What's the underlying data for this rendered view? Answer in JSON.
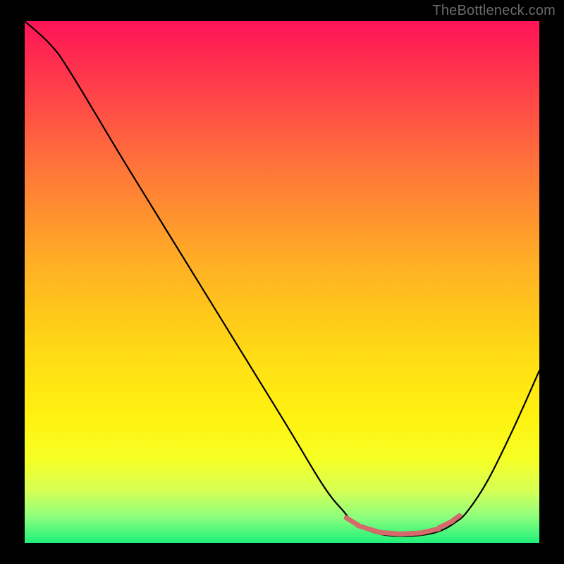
{
  "watermark": "TheBottleneck.com",
  "chart_data": {
    "type": "line",
    "title": "",
    "xlabel": "",
    "ylabel": "",
    "xlim": [
      0,
      100
    ],
    "ylim": [
      0,
      100
    ],
    "grid": false,
    "curve": {
      "name": "bottleneck-curve",
      "points": [
        {
          "x": 0,
          "y": 100
        },
        {
          "x": 5,
          "y": 95.5
        },
        {
          "x": 9,
          "y": 90
        },
        {
          "x": 20,
          "y": 72
        },
        {
          "x": 35,
          "y": 48
        },
        {
          "x": 50,
          "y": 24
        },
        {
          "x": 58,
          "y": 11
        },
        {
          "x": 62,
          "y": 6
        },
        {
          "x": 64,
          "y": 3.8
        },
        {
          "x": 67,
          "y": 2.3
        },
        {
          "x": 70,
          "y": 1.5
        },
        {
          "x": 74,
          "y": 1.3
        },
        {
          "x": 78,
          "y": 1.6
        },
        {
          "x": 81,
          "y": 2.4
        },
        {
          "x": 83.5,
          "y": 3.8
        },
        {
          "x": 86,
          "y": 6
        },
        {
          "x": 90,
          "y": 12
        },
        {
          "x": 95,
          "y": 22
        },
        {
          "x": 100,
          "y": 33
        }
      ]
    },
    "accent_segments": [
      {
        "x0": 62.5,
        "x1": 64.8,
        "y0": 4.8,
        "y1": 3.4
      },
      {
        "x0": 64.8,
        "x1": 69.0,
        "y0": 3.3,
        "y1": 2.0
      },
      {
        "x0": 69.0,
        "x1": 73.0,
        "y0": 2.0,
        "y1": 1.7
      },
      {
        "x0": 73.0,
        "x1": 77.0,
        "y0": 1.7,
        "y1": 1.9
      },
      {
        "x0": 77.0,
        "x1": 80.5,
        "y0": 1.9,
        "y1": 2.7
      },
      {
        "x0": 80.5,
        "x1": 83.2,
        "y0": 2.9,
        "y1": 4.2
      },
      {
        "x0": 83.2,
        "x1": 84.5,
        "y0": 4.3,
        "y1": 5.2
      }
    ],
    "accent_color": "#d46a6a",
    "line_color": "#000000"
  }
}
